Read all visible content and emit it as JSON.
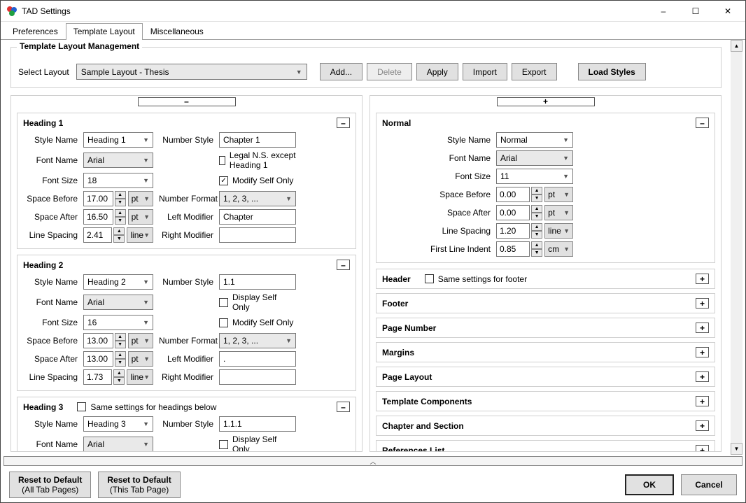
{
  "window": {
    "title": "TAD Settings",
    "minimize": "–",
    "maximize": "☐",
    "close": "✕"
  },
  "tabs": [
    "Preferences",
    "Template Layout",
    "Miscellaneous"
  ],
  "active_tab": 1,
  "group": {
    "title": "Template Layout Management",
    "select_label": "Select Layout",
    "select_value": "Sample Layout - Thesis",
    "buttons": {
      "add": "Add...",
      "delete": "Delete",
      "apply": "Apply",
      "import": "Import",
      "export": "Export",
      "load_styles": "Load Styles"
    }
  },
  "left_toggle": "–",
  "right_toggle": "+",
  "labels": {
    "style_name": "Style Name",
    "font_name": "Font Name",
    "font_size": "Font Size",
    "space_before": "Space Before",
    "space_after": "Space After",
    "line_spacing": "Line Spacing",
    "number_style": "Number Style",
    "number_format": "Number Format",
    "left_modifier": "Left Modifier",
    "right_modifier": "Right Modifier",
    "first_line_indent": "First Line Indent",
    "legal_except_h1": "Legal N.S. except Heading 1",
    "modify_self_only": "Modify Self Only",
    "display_self_only": "Display Self Only",
    "same_settings_below": "Same settings for headings below",
    "same_settings_footer": "Same settings for footer"
  },
  "units": {
    "pt": "pt",
    "line": "line",
    "cm": "cm"
  },
  "heading1": {
    "title": "Heading 1",
    "style": "Heading 1",
    "font": "Arial",
    "size": "18",
    "before": "17.00",
    "after": "16.50",
    "spacing": "2.41",
    "num_style": "Chapter 1",
    "num_format": "1, 2, 3, ...",
    "left_mod": "Chapter",
    "right_mod": "",
    "legal_checked": false,
    "modify_checked": true
  },
  "heading2": {
    "title": "Heading 2",
    "style": "Heading 2",
    "font": "Arial",
    "size": "16",
    "before": "13.00",
    "after": "13.00",
    "spacing": "1.73",
    "num_style": "1.1",
    "num_format": "1, 2, 3, ...",
    "left_mod": ".",
    "right_mod": "",
    "display_checked": false,
    "modify_checked": false
  },
  "heading3": {
    "title": "Heading 3",
    "same_below_checked": false,
    "style": "Heading 3",
    "font": "Arial",
    "num_style": "1.1.1",
    "display_checked": false
  },
  "normal": {
    "title": "Normal",
    "style": "Normal",
    "font": "Arial",
    "size": "11",
    "before": "0.00",
    "after": "0.00",
    "spacing": "1.20",
    "indent": "0.85"
  },
  "right_sections": {
    "header": "Header",
    "footer": "Footer",
    "page_number": "Page Number",
    "margins": "Margins",
    "page_layout": "Page Layout",
    "template_components": "Template Components",
    "chapter_section": "Chapter and Section",
    "references": "References List"
  },
  "footer_btns": {
    "reset_all_1": "Reset to Default",
    "reset_all_2": "(All Tab Pages)",
    "reset_this_1": "Reset to Default",
    "reset_this_2": "(This Tab Page)",
    "ok": "OK",
    "cancel": "Cancel"
  }
}
